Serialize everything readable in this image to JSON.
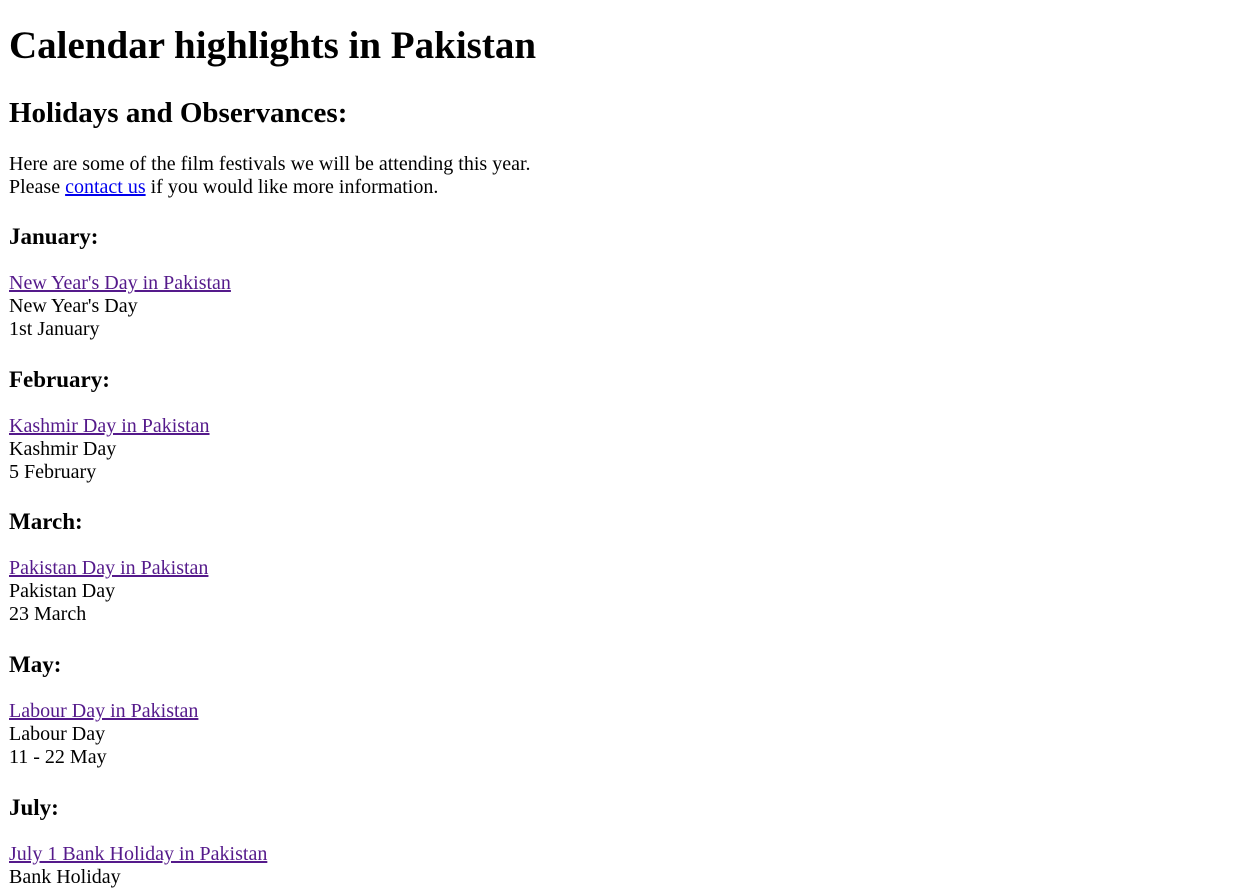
{
  "page": {
    "title": "Calendar highlights in Pakistan",
    "subtitle": "Holidays and Observances:",
    "intro_line1": "Here are some of the film festivals we will be attending this year.",
    "intro_prefix": "Please ",
    "intro_link": "contact us",
    "intro_suffix": " if you would like more information."
  },
  "months": [
    {
      "heading": "January:",
      "link": "New Year's Day in Pakistan",
      "name": "New Year's Day",
      "date": "1st January"
    },
    {
      "heading": "February:",
      "link": "Kashmir Day in Pakistan",
      "name": "Kashmir Day",
      "date": "5 February"
    },
    {
      "heading": "March:",
      "link": "Pakistan Day in Pakistan",
      "name": "Pakistan Day",
      "date": "23 March"
    },
    {
      "heading": "May:",
      "link": "Labour Day in Pakistan",
      "name": "Labour Day",
      "date": "11 - 22 May"
    },
    {
      "heading": "July:",
      "link": "July 1 Bank Holiday in Pakistan",
      "name": "Bank Holiday",
      "date": ""
    }
  ]
}
